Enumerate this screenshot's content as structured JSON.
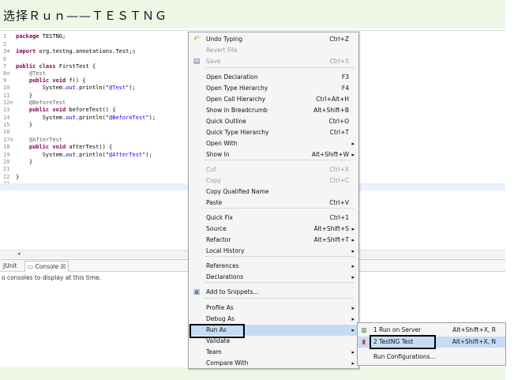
{
  "heading": "选择Ｒｕｎ——ＴＥＳＴＮＧ",
  "editor": {
    "line_numbers": [
      "1",
      "2",
      "3⊕",
      "6",
      "7",
      "8⊖",
      "9",
      "10",
      "11",
      "12⊖",
      "13",
      "14",
      "15",
      "16",
      "17⊖",
      "18",
      "19",
      "20",
      "21",
      "22",
      "23"
    ],
    "lines": [
      {
        "pre": "",
        "kw": "package",
        "post": " TESTNG;"
      },
      {
        "pre": "",
        "kw": "",
        "post": ""
      },
      {
        "pre": "",
        "kw": "import",
        "post": " org.testng.annotations.Test;▯"
      },
      {
        "pre": "",
        "kw": "",
        "post": ""
      },
      {
        "pre": "",
        "kw": "public class",
        "post": " FirstTest {"
      },
      {
        "pre": "    ",
        "ann": "@Test",
        "post": ""
      },
      {
        "pre": "    ",
        "kw": "public void",
        "post": " f() {"
      },
      {
        "pre": "        System.",
        "fld": "out",
        "post": ".println(\"",
        "str": "@Test",
        "tail": "\");"
      },
      {
        "pre": "    ",
        "kw": "",
        "post": "}"
      },
      {
        "pre": "    ",
        "ann": "@BeforeTest",
        "post": ""
      },
      {
        "pre": "    ",
        "kw": "public void",
        "post": " beforeTest() {"
      },
      {
        "pre": "        System.",
        "fld": "out",
        "post": ".println(\"",
        "str": "@BeforeTest",
        "tail": "\");"
      },
      {
        "pre": "    ",
        "kw": "",
        "post": "}"
      },
      {
        "pre": "",
        "kw": "",
        "post": ""
      },
      {
        "pre": "    ",
        "ann": "@AfterTest",
        "post": ""
      },
      {
        "pre": "    ",
        "kw": "public void",
        "post": " afterTest() {"
      },
      {
        "pre": "        System.",
        "fld": "out",
        "post": ".println(\"",
        "str": "@AfterTest",
        "tail": "\");"
      },
      {
        "pre": "    ",
        "kw": "",
        "post": "}"
      },
      {
        "pre": "",
        "kw": "",
        "post": ""
      },
      {
        "pre": "",
        "kw": "",
        "post": "}"
      },
      {
        "pre": "",
        "kw": "",
        "post": ""
      }
    ]
  },
  "console": {
    "tab_junit": "JUnit",
    "tab_console": "Console ☒",
    "message": "o consoles to display at this time."
  },
  "menu": {
    "items": [
      {
        "label": "Undo Typing",
        "shortcut": "Ctrl+Z",
        "icon": "undo-icon",
        "glyph": "↶",
        "disabled": false
      },
      {
        "label": "Revert File",
        "shortcut": "",
        "disabled": true
      },
      {
        "label": "Save",
        "shortcut": "Ctrl+S",
        "icon": "save-icon",
        "glyph": "▤",
        "disabled": true
      },
      {
        "label": "Open Declaration",
        "shortcut": "F3",
        "disabled": false
      },
      {
        "label": "Open Type Hierarchy",
        "shortcut": "F4",
        "disabled": false
      },
      {
        "label": "Open Call Hierarchy",
        "shortcut": "Ctrl+Alt+H",
        "disabled": false
      },
      {
        "label": "Show in Breadcrumb",
        "shortcut": "Alt+Shift+B",
        "disabled": false
      },
      {
        "label": "Quick Outline",
        "shortcut": "Ctrl+O",
        "disabled": false
      },
      {
        "label": "Quick Type Hierarchy",
        "shortcut": "Ctrl+T",
        "disabled": false
      },
      {
        "label": "Open With",
        "shortcut": "",
        "submenu": true,
        "disabled": false
      },
      {
        "label": "Show In",
        "shortcut": "Alt+Shift+W",
        "submenu": true,
        "disabled": false
      },
      {
        "label": "Cut",
        "shortcut": "Ctrl+X",
        "disabled": true
      },
      {
        "label": "Copy",
        "shortcut": "Ctrl+C",
        "disabled": true
      },
      {
        "label": "Copy Qualified Name",
        "shortcut": "",
        "disabled": false
      },
      {
        "label": "Paste",
        "shortcut": "Ctrl+V",
        "disabled": false
      },
      {
        "label": "Quick Fix",
        "shortcut": "Ctrl+1",
        "disabled": false
      },
      {
        "label": "Source",
        "shortcut": "Alt+Shift+S",
        "submenu": true,
        "disabled": false
      },
      {
        "label": "Refactor",
        "shortcut": "Alt+Shift+T",
        "submenu": true,
        "disabled": false
      },
      {
        "label": "Local History",
        "shortcut": "",
        "submenu": true,
        "disabled": false
      },
      {
        "label": "References",
        "shortcut": "",
        "submenu": true,
        "disabled": false
      },
      {
        "label": "Declarations",
        "shortcut": "",
        "submenu": true,
        "disabled": false
      },
      {
        "label": "Add to Snippets...",
        "shortcut": "",
        "icon": "snippet-icon",
        "glyph": "▣",
        "disabled": false
      },
      {
        "label": "Profile As",
        "shortcut": "",
        "submenu": true,
        "disabled": false
      },
      {
        "label": "Debug As",
        "shortcut": "",
        "submenu": true,
        "disabled": false
      },
      {
        "label": "Run As",
        "shortcut": "",
        "submenu": true,
        "selected": true,
        "disabled": false
      },
      {
        "label": "Validate",
        "shortcut": "",
        "disabled": false
      },
      {
        "label": "Team",
        "shortcut": "",
        "submenu": true,
        "disabled": false
      },
      {
        "label": "Compare With",
        "shortcut": "",
        "submenu": true,
        "disabled": false
      }
    ]
  },
  "submenu": {
    "items": [
      {
        "label": "1 Run on Server",
        "shortcut": "Alt+Shift+X, R",
        "icon": "server-run-icon",
        "glyph": "▥"
      },
      {
        "label": "2 TestNG Test",
        "shortcut": "Alt+Shift+X, N",
        "icon": "testng-icon",
        "glyph": "▮",
        "selected": true
      },
      {
        "label": "Run Configurations...",
        "shortcut": ""
      }
    ]
  }
}
